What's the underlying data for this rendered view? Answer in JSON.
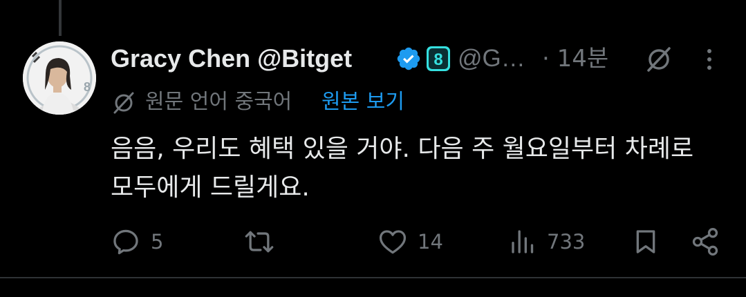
{
  "tweet": {
    "display_name": "Gracy Chen @Bitget",
    "handle": "@G…",
    "separator": "·",
    "timestamp": "14분",
    "translation_note": "원문 언어 중국어",
    "show_original": "원본 보기",
    "text_lines": [
      "음음, 우리도 혜택 있을 거야. 다음 주 월요일부터 차례로",
      "모두에게 드릴게요."
    ],
    "affiliate_badge": "8"
  },
  "actions": {
    "reply_count": "5",
    "like_count": "14",
    "view_count": "733"
  },
  "icons": {
    "verified": "verified-badge-icon",
    "affiliate": "bitget-affiliate-icon",
    "grok": "grok-icon",
    "more": "more-icon",
    "translate": "translate-icon",
    "reply": "reply-icon",
    "retweet": "retweet-icon",
    "like": "heart-icon",
    "views": "views-icon",
    "bookmark": "bookmark-icon",
    "share": "share-icon"
  },
  "colors": {
    "background": "#000000",
    "text_primary": "#e7e9ea",
    "text_secondary": "#71767b",
    "link": "#1d9bf0",
    "verified": "#1d9bf0",
    "affiliate": "#35e0e0",
    "divider": "#2f3336"
  }
}
